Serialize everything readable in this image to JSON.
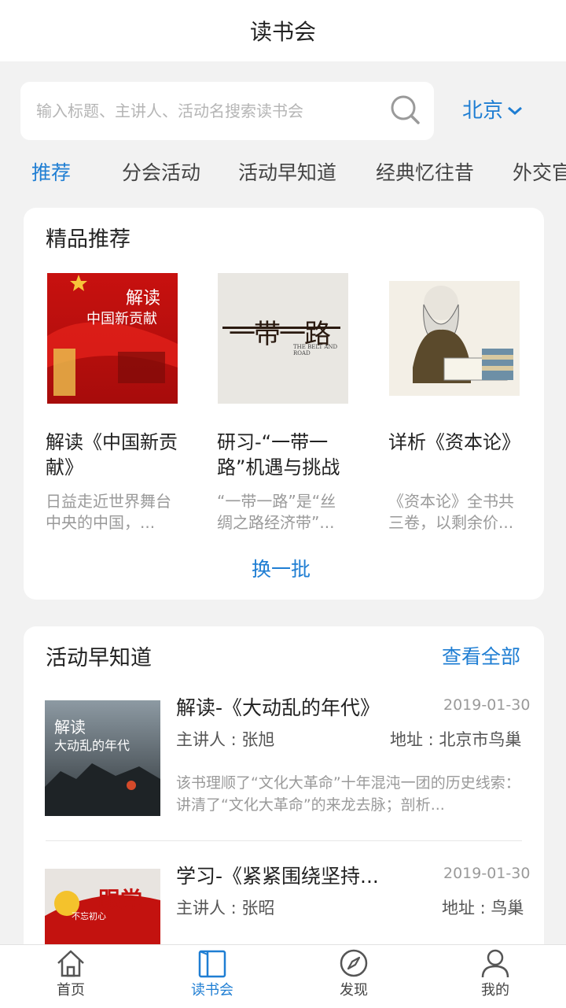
{
  "header": {
    "title": "读书会"
  },
  "search": {
    "placeholder": "输入标题、主讲人、活动名搜索读书会",
    "city": "北京"
  },
  "tabs": [
    {
      "label": "推荐"
    },
    {
      "label": "分会活动"
    },
    {
      "label": "活动早知道"
    },
    {
      "label": "经典忆往昔"
    },
    {
      "label": "外交官"
    }
  ],
  "featured": {
    "title": "精品推荐",
    "refresh_label": "换一批",
    "books": [
      {
        "cover_text_1": "解读",
        "cover_text_2": "中国新贡献",
        "title": "解读《中国新贡献》",
        "desc": "日益走近世界舞台中央的中国，..."
      },
      {
        "cover_text_1": "一带一路",
        "cover_text_2": "THE BELT AND ROAD",
        "title": "研习-“一带一路”机遇与挑战",
        "desc": "“一带一路”是“丝绸之路经济带”..."
      },
      {
        "title": "详析《资本论》",
        "desc": "《资本论》全书共三卷，以剩余价..."
      }
    ]
  },
  "upcoming": {
    "title": "活动早知道",
    "view_all_label": "查看全部",
    "items": [
      {
        "cover_text_1": "解读",
        "cover_text_2": "大动乱的年代",
        "title": "解读-《大动乱的年代》",
        "date": "2019-01-30",
        "speaker": "主讲人 : 张旭",
        "address": "地址 : 北京市鸟巢",
        "desc": "该书理顺了“文化大革命”十年混沌一团的历史线索：讲清了“文化大革命”的来龙去脉；剖析..."
      },
      {
        "cover_text_1": "跟党",
        "cover_text_2": "不忘初心",
        "title": "学习-《紧紧围绕坚持...",
        "date": "2019-01-30",
        "speaker": "主讲人 : 张昭",
        "address": "地址 : 鸟巢"
      }
    ]
  },
  "tabbar": [
    {
      "label": "首页",
      "icon": "home-icon"
    },
    {
      "label": "读书会",
      "icon": "book-icon"
    },
    {
      "label": "发现",
      "icon": "compass-icon"
    },
    {
      "label": "我的",
      "icon": "user-icon"
    }
  ],
  "colors": {
    "accent": "#1f7ed3",
    "background": "#f2f2f2",
    "card": "#ffffff",
    "muted_text": "#9a9a9a"
  }
}
